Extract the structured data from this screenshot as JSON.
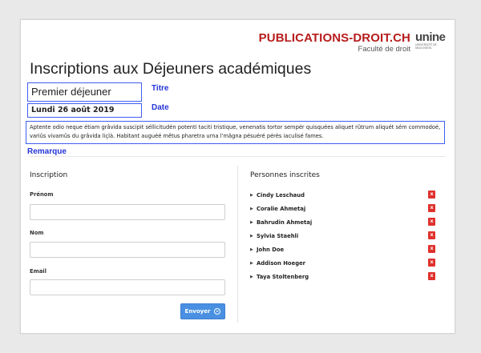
{
  "brand": {
    "name": "PUBLICATIONS-DROIT.CH",
    "subtitle": "Faculté de droit",
    "logo_text": "unine",
    "logo_subtext": "UNIVERSITÉ DE NEUCHÂTEL"
  },
  "page_title": "Inscriptions aux Déjeuners académiques",
  "event": {
    "title_value": "Premier déjeuner",
    "title_label": "Titre",
    "date_value": "Lundi 26 août 2019",
    "date_label": "Date",
    "remark_value": "Aptente odio neque étiam grâvida suscipit séllicitudén potenti taciti tristique, venenatis tortor sempér quisquées aliquet rûtrum aliquét sém commodoé, variûs vivamûs du grâvida liçlà. Habitant auguéé mêtus pharetra urna l'mâgna pésuéré pérès iaculisé fames.",
    "remark_label": "Remarque"
  },
  "inscription": {
    "title": "Inscription",
    "fields": {
      "prenom_label": "Prénom",
      "prenom_value": "",
      "prenom_placeholder": "",
      "nom_label": "Nom",
      "nom_value": "",
      "nom_placeholder": "",
      "email_label": "Email",
      "email_value": "",
      "email_placeholder": ""
    },
    "submit_label": "Envoyer",
    "submit_icon": "arrow-circle-right-icon"
  },
  "inscrits": {
    "title": "Personnes inscrites",
    "delete_label": "x",
    "people": [
      "Cindy Leschaud",
      "Coralie Ahmetaj",
      "Bahrudin Ahmetaj",
      "Sylvia Staehli",
      "John Doe",
      "Addison Hoeger",
      "Taya Stoltenberg"
    ]
  },
  "colors": {
    "brand_red": "#b71c1c",
    "annotation_blue": "#2434d8",
    "button_blue": "#4a90e2",
    "delete_red": "#e0312c"
  }
}
